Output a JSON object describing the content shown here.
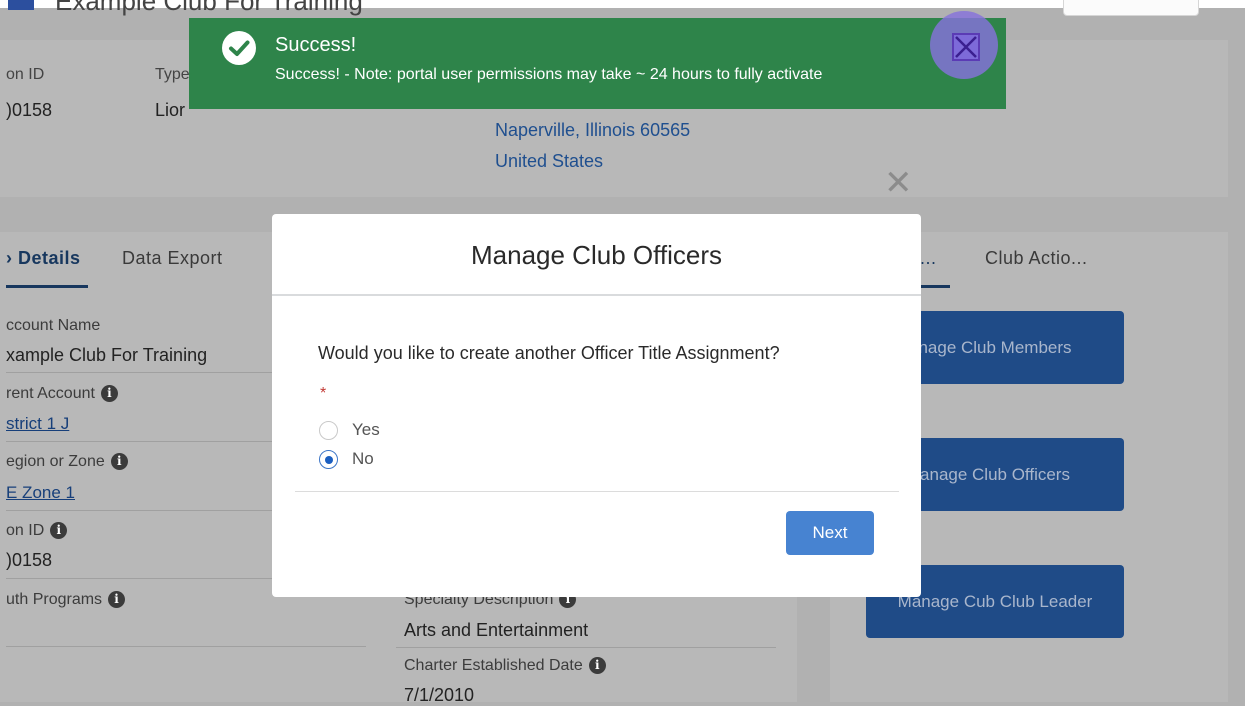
{
  "header": {
    "title": "Example Club For Training"
  },
  "highlights": {
    "fields": [
      {
        "label": "on ID",
        "value": ")0158"
      },
      {
        "label": "Type",
        "value": "Lior"
      }
    ],
    "address_lines": [
      "Naperville, Illinois 60565",
      "United States"
    ]
  },
  "tabs": [
    {
      "label": "› Details"
    },
    {
      "label": "Data Export"
    }
  ],
  "right_tabs": [
    {
      "label": "..."
    },
    {
      "label": "Club Actio..."
    }
  ],
  "details": {
    "account_name_label": "ccount Name",
    "account_name_value": "xample Club For Training",
    "parent_account_label": "rent Account",
    "parent_account_value": "strict 1 J",
    "region_label": "egion or Zone",
    "region_value": "E Zone 1",
    "on_id_label": "on ID",
    "on_id_value": ")0158",
    "youth_label": "uth Programs",
    "specialty_label": "Specialty Description",
    "specialty_value": "Arts and Entertainment",
    "charter_label": "Charter Established Date",
    "charter_value": "7/1/2010"
  },
  "actions": {
    "manage_members": "nage Club Members",
    "manage_officers": "anage Club Officers",
    "manage_cub_leader": "Manage Cub Club Leader"
  },
  "toast": {
    "title": "Success!",
    "message": "Success! - Note: portal user permissions may take ~ 24 hours to fully activate",
    "color": "#2e844a"
  },
  "modal": {
    "title": "Manage Club Officers",
    "question": "Would you like to create another Officer Title Assignment?",
    "required_mark": "*",
    "options": [
      {
        "label": "Yes",
        "selected": false
      },
      {
        "label": "No",
        "selected": true
      }
    ],
    "next_label": "Next"
  },
  "colors": {
    "accent": "#4783d1",
    "link": "#1f4f8f",
    "action_button": "#1f4b87"
  }
}
